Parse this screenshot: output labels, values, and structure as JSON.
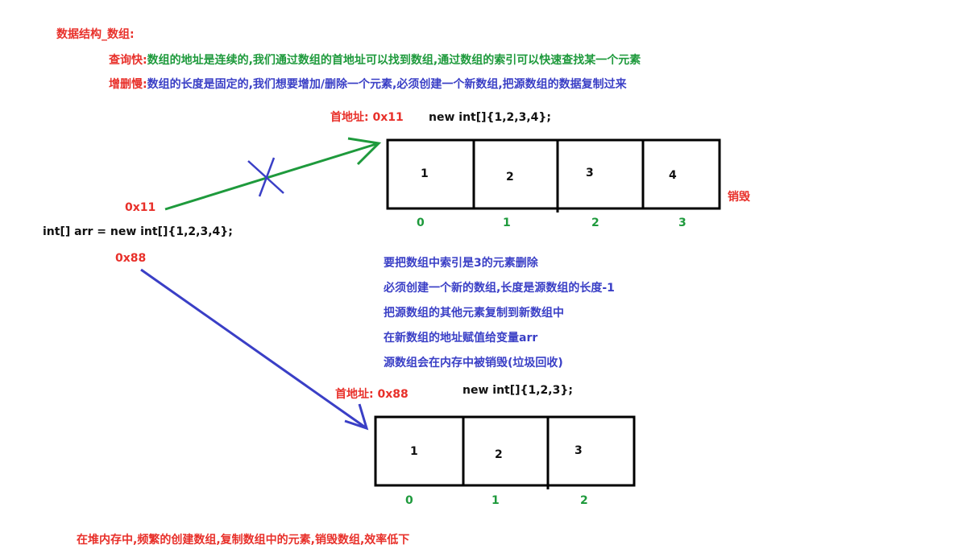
{
  "title": "数据结构_数组:",
  "query_fast": {
    "label": "查询快:",
    "text": "数组的地址是连续的,我们通过数组的首地址可以找到数组,通过数组的索引可以快速查找某一个元素"
  },
  "add_delete_slow": {
    "label": "增删慢:",
    "text": "数组的长度是固定的,我们想要增加/删除一个元素,必须创建一个新数组,把源数组的数据复制过来"
  },
  "array1": {
    "address_label": "首地址: 0x11",
    "code": "new int[]{1,2,3,4};",
    "values": [
      "1",
      "2",
      "3",
      "4"
    ],
    "indices": [
      "0",
      "1",
      "2",
      "3"
    ],
    "destroyed_label": "销毁"
  },
  "array2": {
    "address_label": "首地址: 0x88",
    "code": "new int[]{1,2,3};",
    "values": [
      "1",
      "2",
      "3"
    ],
    "indices": [
      "0",
      "1",
      "2"
    ]
  },
  "variable": {
    "code": "int[] arr = new int[]{1,2,3,4};",
    "old_ref": "0x11",
    "new_ref": "0x88"
  },
  "steps": [
    "要把数组中索引是3的元素删除",
    "必须创建一个新的数组,长度是源数组的长度-1",
    "把源数组的其他元素复制到新数组中",
    "在新数组的地址赋值给变量arr",
    "源数组会在内存中被销毁(垃圾回收)"
  ],
  "footer": "在堆内存中,频繁的创建数组,复制数组中的元素,销毁数组,效率低下",
  "colors": {
    "red": "#e8302a",
    "green": "#1e9a3c",
    "blue": "#3a3fc6"
  }
}
